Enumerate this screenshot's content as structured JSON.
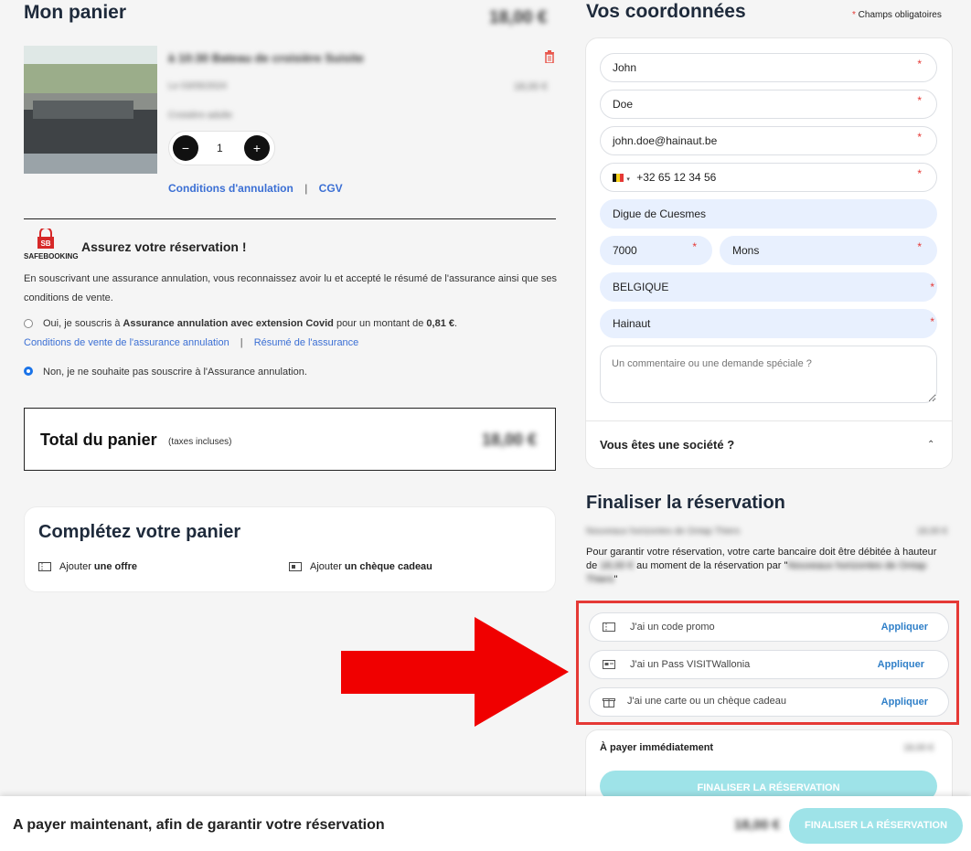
{
  "cart": {
    "title": "Mon panier",
    "total_header": "18,00 €",
    "item_title": "à 10:30 Bateau de croisière Suisite",
    "item_date": "Le 03/05/2024",
    "item_price": "18,00 €",
    "item_type": "Croisière adulte",
    "quantity": "1",
    "decrement": "−",
    "increment": "+",
    "cancel_conditions": "Conditions d'annulation",
    "separator": "|",
    "cgv": "CGV"
  },
  "insurance": {
    "logo_text": "SAFEBOOKING",
    "logo_mark": "SB",
    "title": "Assurez votre réservation !",
    "description": "En souscrivant une assurance annulation, vous reconnaissez avoir lu et accepté le résumé de l'assurance ainsi que ses conditions de vente.",
    "option_yes_pre": "Oui, je souscris à ",
    "option_yes_bold": "Assurance annulation avec extension Covid",
    "option_yes_mid": " pour un montant de ",
    "option_yes_amount": "0,81 €",
    "option_yes_end": ".",
    "link_conditions": "Conditions de vente de l'assurance annulation",
    "link_sep": "|",
    "link_summary": "Résumé de l'assurance",
    "option_no": "Non, je ne souhaite pas souscrire à l'Assurance annulation."
  },
  "total": {
    "label": "Total du panier",
    "taxes": "(taxes incluses)",
    "amount": "18,00 €"
  },
  "complete": {
    "title": "Complétez votre panier",
    "offer_pre": "Ajouter ",
    "offer_bold": "une offre",
    "gift_pre": "Ajouter ",
    "gift_bold": "un chèque cadeau"
  },
  "contact": {
    "title": "Vos coordonnées",
    "required_star": "*",
    "required_note": " Champs obligatoires",
    "first_name": "John",
    "last_name": "Doe",
    "email": "john.doe@hainaut.be",
    "phone": "+32 65 12 34 56",
    "street": "Digue de Cuesmes",
    "zip": "7000",
    "city": "Mons",
    "country": "BELGIQUE",
    "region": "Hainaut",
    "comment_placeholder": "Un commentaire ou une demande spéciale ?",
    "company_question": "Vous êtes une société ?"
  },
  "finalize": {
    "title": "Finaliser la réservation",
    "line_label": "Nouveaux horizontes de Ontap Thiers",
    "line_amount": "18,00 €",
    "notice_1": "Pour garantir votre réservation, votre carte bancaire doit être débitée à hauteur",
    "notice_de": "de",
    "notice_amount": "18,00 €",
    "notice_2": "au moment de la réservation par \"",
    "notice_merchant": "Nouveaux horizontes de Ontap",
    "notice_merchant_2": "Thiers",
    "notice_end": "\"",
    "promo_code": "J'ai un code promo",
    "pass": "J'ai un Pass VISITWallonia",
    "gift_card": "J'ai une carte ou un chèque cadeau",
    "apply": "Appliquer",
    "pay_now_label": "À payer immédiatement",
    "pay_now_amount": "18,00 €",
    "button": "FINALISER LA RÉSERVATION"
  },
  "footer": {
    "text": "A payer maintenant, afin de garantir votre réservation",
    "amount": "18,00 €",
    "button": "FINALISER LA RÉSERVATION"
  },
  "colors": {
    "accent": "#3b6fd4",
    "button": "#9ee3e8",
    "arrow": "#f00000",
    "highlight": "#e53935"
  }
}
